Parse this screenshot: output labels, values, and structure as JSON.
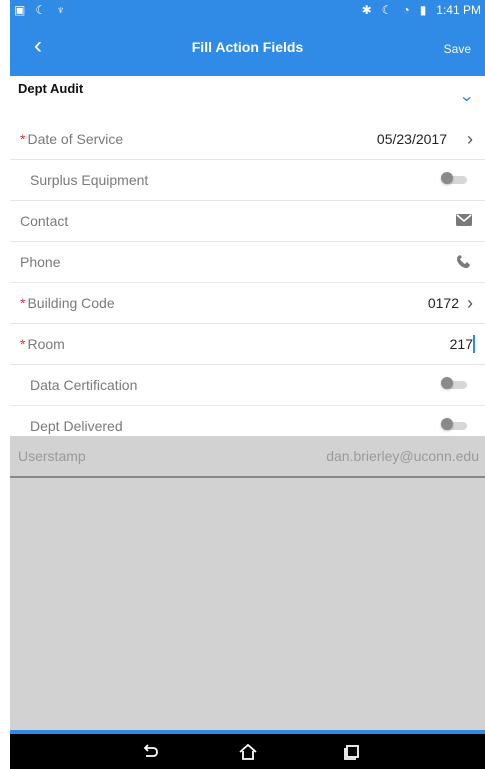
{
  "status_bar": {
    "time": "1:41 PM"
  },
  "appbar": {
    "title": "Fill Action Fields",
    "save_label": "Save"
  },
  "section": {
    "title": "Dept Audit"
  },
  "rows": [
    {
      "label": "Date of Service",
      "required": true,
      "value": "05/23/2017",
      "type": "nav"
    },
    {
      "label": "Surplus Equipment",
      "required": false,
      "type": "toggle",
      "on": false
    },
    {
      "label": "Contact",
      "required": false,
      "type": "icon",
      "icon": "email-icon"
    },
    {
      "label": "Phone",
      "required": false,
      "type": "icon",
      "icon": "phone-icon"
    },
    {
      "label": "Building Code",
      "required": true,
      "value": "0172",
      "type": "nav"
    },
    {
      "label": "Room",
      "required": true,
      "value": "217",
      "type": "text"
    },
    {
      "label": "Data Certification",
      "required": false,
      "type": "toggle",
      "on": false
    },
    {
      "label": "Dept Delivered",
      "required": false,
      "type": "toggle",
      "on": false
    }
  ],
  "userstamp": {
    "label": "Userstamp",
    "value": "dan.brierley@uconn.edu"
  },
  "colors": {
    "primary": "#2f8be6",
    "required": "#d33333",
    "disabled_bg": "#d2d2d2"
  }
}
